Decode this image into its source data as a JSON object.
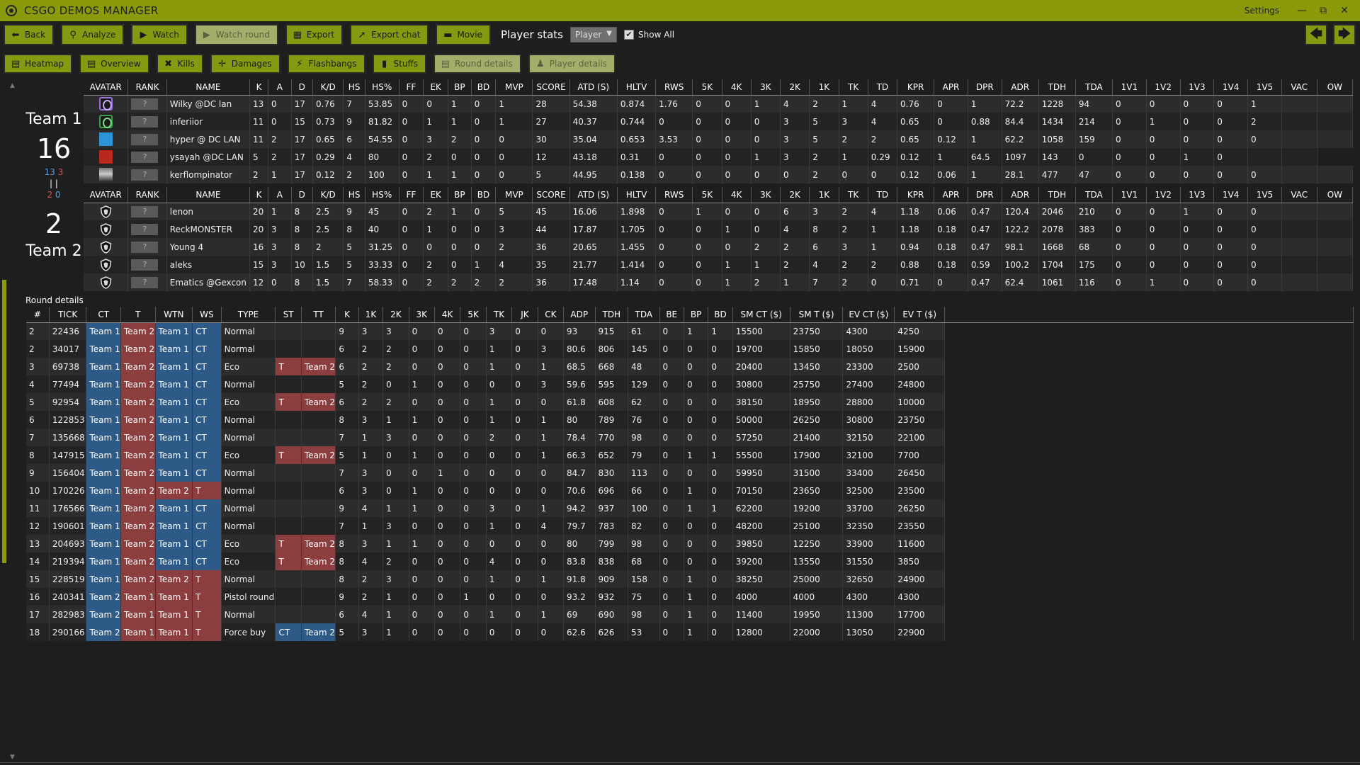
{
  "app": {
    "title": "CSGO DEMOS MANAGER",
    "settings_label": "Settings",
    "minimize": "—",
    "restore": "⧉",
    "close": "✕"
  },
  "toolbar": {
    "back": "Back",
    "analyze": "Analyze",
    "watch": "Watch",
    "watch_round": "Watch round",
    "export": "Export",
    "export_chat": "Export chat",
    "movie": "Movie",
    "player_stats": "Player stats",
    "player_select": "Player",
    "show_all": "Show All",
    "prev": "🡄",
    "next": "🡆"
  },
  "tabs": {
    "heatmap": "Heatmap",
    "overview": "Overview",
    "kills": "Kills",
    "damages": "Damages",
    "flashbangs": "Flashbangs",
    "stuffs": "Stuffs",
    "round_details": "Round details",
    "player_details": "Player details"
  },
  "team1": {
    "name": "Team 1",
    "score": "16",
    "half_first_ct": "13",
    "half_first_t": "3",
    "half_second_ct": "2",
    "half_second_t": "0",
    "sep": "|  |"
  },
  "team2": {
    "name": "Team 2",
    "score": "2"
  },
  "player_columns": [
    "AVATAR",
    "RANK",
    "NAME",
    "K",
    "A",
    "D",
    "K/D",
    "HS",
    "HS%",
    "FF",
    "EK",
    "BP",
    "BD",
    "MVP",
    "SCORE",
    "ATD (S)",
    "HLTV",
    "RWS",
    "5K",
    "4K",
    "3K",
    "2K",
    "1K",
    "TK",
    "TD",
    "KPR",
    "APR",
    "DPR",
    "ADR",
    "TDH",
    "TDA",
    "1V1",
    "1V2",
    "1V3",
    "1V4",
    "1V5",
    "VAC",
    "OW"
  ],
  "team1_players": [
    {
      "avatar": "purple",
      "rank": "?",
      "cells": [
        "Wilky @DC lan",
        "13",
        "0",
        "17",
        "0.76",
        "7",
        "53.85",
        "0",
        "0",
        "1",
        "0",
        "1",
        "28",
        "54.38",
        "0.874",
        "1.76",
        "0",
        "0",
        "1",
        "4",
        "2",
        "1",
        "4",
        "0.76",
        "0",
        "1",
        "72.2",
        "1228",
        "94",
        "0",
        "0",
        "0",
        "0",
        "1",
        "",
        ""
      ]
    },
    {
      "avatar": "green",
      "rank": "?",
      "cells": [
        "inferiior",
        "11",
        "0",
        "15",
        "0.73",
        "9",
        "81.82",
        "0",
        "1",
        "1",
        "0",
        "1",
        "27",
        "40.37",
        "0.744",
        "0",
        "0",
        "0",
        "0",
        "3",
        "5",
        "3",
        "4",
        "0.65",
        "0",
        "0.88",
        "84.4",
        "1434",
        "214",
        "0",
        "1",
        "0",
        "0",
        "2",
        "",
        ""
      ]
    },
    {
      "avatar": "blue",
      "rank": "?",
      "cells": [
        "hyper @ DC LAN",
        "11",
        "2",
        "17",
        "0.65",
        "6",
        "54.55",
        "0",
        "3",
        "2",
        "0",
        "0",
        "30",
        "35.04",
        "0.653",
        "3.53",
        "0",
        "0",
        "0",
        "3",
        "5",
        "2",
        "2",
        "0.65",
        "0.12",
        "1",
        "62.2",
        "1058",
        "159",
        "0",
        "0",
        "0",
        "0",
        "0",
        "",
        ""
      ]
    },
    {
      "avatar": "red",
      "rank": "?",
      "cells": [
        "ysayah @DC LAN",
        "5",
        "2",
        "17",
        "0.29",
        "4",
        "80",
        "0",
        "2",
        "0",
        "0",
        "0",
        "12",
        "43.18",
        "0.31",
        "0",
        "0",
        "0",
        "1",
        "3",
        "2",
        "1",
        "0.29",
        "0.12",
        "1",
        "64.5",
        "1097",
        "143",
        "0",
        "0",
        "0",
        "1",
        "0",
        "",
        ""
      ]
    },
    {
      "avatar": "bw",
      "rank": "?",
      "cells": [
        "kerflompinator",
        "2",
        "1",
        "17",
        "0.12",
        "2",
        "100",
        "0",
        "1",
        "1",
        "0",
        "0",
        "5",
        "44.95",
        "0.138",
        "0",
        "0",
        "0",
        "0",
        "0",
        "2",
        "0",
        "0",
        "0.12",
        "0.06",
        "1",
        "28.1",
        "477",
        "47",
        "0",
        "0",
        "0",
        "0",
        "0",
        "",
        ""
      ]
    }
  ],
  "team2_players": [
    {
      "rank": "?",
      "cells": [
        "lenon",
        "20",
        "1",
        "8",
        "2.5",
        "9",
        "45",
        "0",
        "2",
        "1",
        "0",
        "5",
        "45",
        "16.06",
        "1.898",
        "0",
        "1",
        "0",
        "0",
        "6",
        "3",
        "2",
        "4",
        "1.18",
        "0.06",
        "0.47",
        "120.4",
        "2046",
        "210",
        "0",
        "0",
        "1",
        "0",
        "0",
        "",
        ""
      ]
    },
    {
      "rank": "?",
      "cells": [
        "ReckMONSTER",
        "20",
        "3",
        "8",
        "2.5",
        "8",
        "40",
        "0",
        "1",
        "0",
        "0",
        "3",
        "44",
        "17.87",
        "1.705",
        "0",
        "0",
        "1",
        "0",
        "4",
        "8",
        "2",
        "1",
        "1.18",
        "0.18",
        "0.47",
        "122.2",
        "2078",
        "383",
        "0",
        "0",
        "0",
        "0",
        "0",
        "",
        ""
      ]
    },
    {
      "rank": "?",
      "cells": [
        "Young 4",
        "16",
        "3",
        "8",
        "2",
        "5",
        "31.25",
        "0",
        "0",
        "0",
        "0",
        "2",
        "36",
        "20.65",
        "1.455",
        "0",
        "0",
        "0",
        "2",
        "2",
        "6",
        "3",
        "1",
        "0.94",
        "0.18",
        "0.47",
        "98.1",
        "1668",
        "68",
        "0",
        "0",
        "0",
        "0",
        "0",
        "",
        ""
      ]
    },
    {
      "rank": "?",
      "cells": [
        "aleks",
        "15",
        "3",
        "10",
        "1.5",
        "5",
        "33.33",
        "0",
        "2",
        "0",
        "1",
        "4",
        "35",
        "21.77",
        "1.414",
        "0",
        "0",
        "1",
        "1",
        "2",
        "4",
        "2",
        "2",
        "0.88",
        "0.18",
        "0.59",
        "100.2",
        "1704",
        "175",
        "0",
        "0",
        "0",
        "0",
        "0",
        "",
        ""
      ]
    },
    {
      "rank": "?",
      "cells": [
        "Ematics @Gexcon",
        "12",
        "0",
        "8",
        "1.5",
        "7",
        "58.33",
        "0",
        "2",
        "2",
        "2",
        "2",
        "36",
        "17.48",
        "1.14",
        "0",
        "0",
        "1",
        "2",
        "1",
        "7",
        "2",
        "0",
        "0.71",
        "0",
        "0.47",
        "62.4",
        "1061",
        "116",
        "0",
        "1",
        "0",
        "0",
        "0",
        "",
        ""
      ]
    }
  ],
  "round_details_label": "Round details",
  "round_columns": [
    "#",
    "TICK",
    "CT",
    "T",
    "WTN",
    "WS",
    "TYPE",
    "ST",
    "TT",
    "K",
    "1K",
    "2K",
    "3K",
    "4K",
    "5K",
    "TK",
    "JK",
    "CK",
    "ADP",
    "TDH",
    "TDA",
    "BE",
    "BP",
    "BD",
    "SM CT ($)",
    "SM T ($)",
    "EV CT ($)",
    "EV T ($)",
    ""
  ],
  "rounds": [
    [
      "2",
      "22436",
      "Team 1",
      "Team 2",
      "Team 1",
      "CT",
      "Normal",
      "",
      "",
      "9",
      "3",
      "3",
      "0",
      "0",
      "0",
      "3",
      "0",
      "0",
      "93",
      "915",
      "61",
      "0",
      "1",
      "1",
      "15500",
      "23750",
      "4300",
      "4250"
    ],
    [
      "2",
      "34017",
      "Team 1",
      "Team 2",
      "Team 1",
      "CT",
      "Normal",
      "",
      "",
      "6",
      "2",
      "2",
      "0",
      "0",
      "0",
      "1",
      "0",
      "3",
      "80.6",
      "806",
      "145",
      "0",
      "0",
      "0",
      "19700",
      "15850",
      "18050",
      "15900"
    ],
    [
      "3",
      "69738",
      "Team 1",
      "Team 2",
      "Team 1",
      "CT",
      "Eco",
      "T",
      "Team 2",
      "6",
      "2",
      "2",
      "0",
      "0",
      "0",
      "1",
      "0",
      "1",
      "68.5",
      "668",
      "48",
      "0",
      "0",
      "0",
      "20400",
      "13450",
      "23300",
      "2500"
    ],
    [
      "4",
      "77494",
      "Team 1",
      "Team 2",
      "Team 1",
      "CT",
      "Normal",
      "",
      "",
      "5",
      "2",
      "0",
      "1",
      "0",
      "0",
      "0",
      "0",
      "3",
      "59.6",
      "595",
      "129",
      "0",
      "0",
      "0",
      "30800",
      "25750",
      "27400",
      "24800"
    ],
    [
      "5",
      "92954",
      "Team 1",
      "Team 2",
      "Team 1",
      "CT",
      "Eco",
      "T",
      "Team 2",
      "6",
      "2",
      "2",
      "0",
      "0",
      "0",
      "1",
      "0",
      "0",
      "61.8",
      "608",
      "62",
      "0",
      "0",
      "0",
      "38150",
      "18950",
      "28800",
      "10000"
    ],
    [
      "6",
      "122853",
      "Team 1",
      "Team 2",
      "Team 1",
      "CT",
      "Normal",
      "",
      "",
      "8",
      "3",
      "1",
      "1",
      "0",
      "0",
      "1",
      "0",
      "1",
      "80",
      "789",
      "76",
      "0",
      "0",
      "0",
      "50000",
      "26250",
      "30800",
      "23750"
    ],
    [
      "7",
      "135668",
      "Team 1",
      "Team 2",
      "Team 1",
      "CT",
      "Normal",
      "",
      "",
      "7",
      "1",
      "3",
      "0",
      "0",
      "0",
      "2",
      "0",
      "1",
      "78.4",
      "770",
      "98",
      "0",
      "0",
      "0",
      "57250",
      "21400",
      "32150",
      "22100"
    ],
    [
      "8",
      "147915",
      "Team 1",
      "Team 2",
      "Team 1",
      "CT",
      "Eco",
      "T",
      "Team 2",
      "5",
      "1",
      "0",
      "1",
      "0",
      "0",
      "0",
      "0",
      "1",
      "66.3",
      "652",
      "79",
      "0",
      "1",
      "1",
      "55500",
      "17900",
      "32100",
      "7700"
    ],
    [
      "9",
      "156404",
      "Team 1",
      "Team 2",
      "Team 1",
      "CT",
      "Normal",
      "",
      "",
      "7",
      "3",
      "0",
      "0",
      "1",
      "0",
      "0",
      "0",
      "0",
      "84.7",
      "830",
      "113",
      "0",
      "0",
      "0",
      "59950",
      "31500",
      "33400",
      "26450"
    ],
    [
      "10",
      "170226",
      "Team 1",
      "Team 2",
      "Team 2",
      "T",
      "Normal",
      "",
      "",
      "6",
      "3",
      "0",
      "1",
      "0",
      "0",
      "0",
      "0",
      "0",
      "70.6",
      "696",
      "66",
      "0",
      "1",
      "0",
      "70150",
      "23650",
      "32500",
      "23500"
    ],
    [
      "11",
      "176566",
      "Team 1",
      "Team 2",
      "Team 1",
      "CT",
      "Normal",
      "",
      "",
      "9",
      "4",
      "1",
      "1",
      "0",
      "0",
      "3",
      "0",
      "1",
      "94.2",
      "937",
      "100",
      "0",
      "1",
      "1",
      "62200",
      "19200",
      "33700",
      "26250"
    ],
    [
      "12",
      "190601",
      "Team 1",
      "Team 2",
      "Team 1",
      "CT",
      "Normal",
      "",
      "",
      "7",
      "1",
      "3",
      "0",
      "0",
      "0",
      "1",
      "0",
      "4",
      "79.7",
      "783",
      "82",
      "0",
      "0",
      "0",
      "48200",
      "25100",
      "32350",
      "23550"
    ],
    [
      "13",
      "204693",
      "Team 1",
      "Team 2",
      "Team 1",
      "CT",
      "Eco",
      "T",
      "Team 2",
      "8",
      "3",
      "1",
      "1",
      "0",
      "0",
      "0",
      "0",
      "0",
      "80",
      "799",
      "98",
      "0",
      "0",
      "0",
      "39850",
      "12250",
      "33900",
      "11600"
    ],
    [
      "14",
      "219394",
      "Team 1",
      "Team 2",
      "Team 1",
      "CT",
      "Eco",
      "T",
      "Team 2",
      "8",
      "4",
      "2",
      "0",
      "0",
      "0",
      "4",
      "0",
      "0",
      "83.8",
      "838",
      "68",
      "0",
      "0",
      "0",
      "39200",
      "13550",
      "31550",
      "3850"
    ],
    [
      "15",
      "228519",
      "Team 1",
      "Team 2",
      "Team 2",
      "T",
      "Normal",
      "",
      "",
      "8",
      "2",
      "3",
      "0",
      "0",
      "0",
      "1",
      "0",
      "1",
      "91.8",
      "909",
      "158",
      "0",
      "1",
      "0",
      "38250",
      "25000",
      "32650",
      "24900"
    ],
    [
      "16",
      "240341",
      "Team 2",
      "Team 1",
      "Team 1",
      "T",
      "Pistol round",
      "",
      "",
      "9",
      "2",
      "1",
      "0",
      "0",
      "1",
      "0",
      "0",
      "0",
      "93.2",
      "932",
      "75",
      "0",
      "1",
      "0",
      "4000",
      "4000",
      "4300",
      "4300"
    ],
    [
      "17",
      "282983",
      "Team 2",
      "Team 1",
      "Team 1",
      "T",
      "Normal",
      "",
      "",
      "6",
      "4",
      "1",
      "0",
      "0",
      "0",
      "1",
      "0",
      "1",
      "69",
      "690",
      "98",
      "0",
      "1",
      "0",
      "11400",
      "19950",
      "11300",
      "17700"
    ],
    [
      "18",
      "290166",
      "Team 2",
      "Team 1",
      "Team 1",
      "T",
      "Force buy",
      "CT",
      "Team 2",
      "5",
      "3",
      "1",
      "0",
      "0",
      "0",
      "0",
      "0",
      "0",
      "62.6",
      "626",
      "53",
      "0",
      "1",
      "0",
      "12800",
      "22000",
      "13050",
      "22900"
    ]
  ],
  "colors": {
    "accent": "#8a9a0a",
    "ct": "#2d5a86",
    "t": "#8c3e3e"
  }
}
